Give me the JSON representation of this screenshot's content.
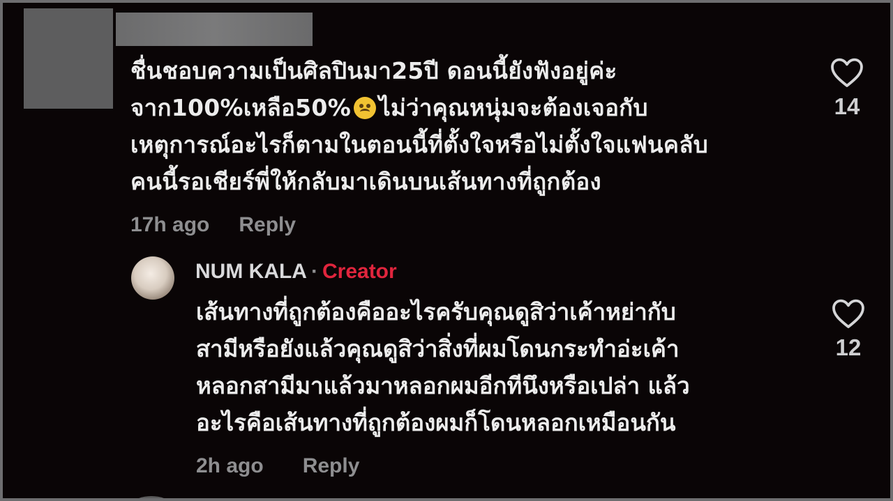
{
  "comment": {
    "lines": [
      "ชื่นชอบความเป็นศิลปินมา25ปี ดอนนี้ยังฟังอยู่ค่ะ",
      "จาก100%เหลือ50%",
      "ไม่ว่าคุณหนุ่มจะต้องเจอกับ",
      "เหตุการณ์อะไรก็ตามในตอนนี้ที่ตั้งใจหรือไม่ตั้งใจแฟนคลับ",
      "คนนี้รอเชียร์พี่ให้กลับมาเดินบนเส้นทางที่ถูกต้อง"
    ],
    "emoji": "frowning-face",
    "time": "17h ago",
    "reply_label": "Reply",
    "likes": "14"
  },
  "reply": {
    "author": "NUM KALA",
    "separator": "·",
    "badge": "Creator",
    "lines": [
      "เส้นทางที่ถูกต้องคืออะไรครับคุณดูสิว่าเค้าหย่ากับ",
      "สามีหรือยังแล้วคุณดูสิว่าสิ่งที่ผมโดนกระทำอ่ะเค้า",
      "หลอกสามีมาแล้วมาหลอกผมอีกทีนึงหรือเปล่า แล้ว",
      "อะไรคือเส้นทางที่ถูกต้องผมก็โดนหลอกเหมือนกัน"
    ],
    "time": "2h ago",
    "reply_label": "Reply",
    "likes": "12"
  },
  "colors": {
    "background": "#0a0506",
    "text": "#ececec",
    "muted": "#8e8e90",
    "creator_badge": "#e0253d"
  },
  "icons": {
    "like": "heart-outline-icon"
  }
}
